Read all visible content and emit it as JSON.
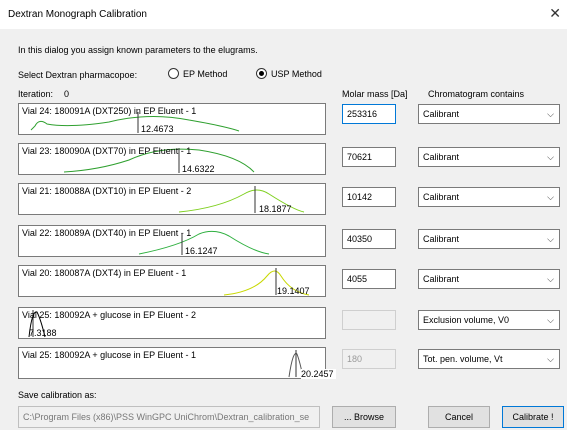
{
  "window": {
    "title": "Dextran Monograph Calibration",
    "close_glyph": "✕"
  },
  "intro": "In this dialog you assign known parameters to the elugrams.",
  "pharmacopoe": {
    "label": "Select Dextran pharmacopoe:",
    "options": [
      {
        "label": "EP Method",
        "selected": false
      },
      {
        "label": "USP Method",
        "selected": true
      }
    ]
  },
  "iteration": {
    "label": "Iteration:",
    "value": "0"
  },
  "columns": {
    "molar_mass": "Molar mass [Da]",
    "contains": "Chromatogram contains"
  },
  "rows": [
    {
      "vial": "Vial  24: 180091A (DXT250) in EP Eluent - 1",
      "peak": "12.4673",
      "molar_mass": "253316",
      "contains": "Calibrant",
      "mass_state": "focused",
      "curve_color": "#2fa02f"
    },
    {
      "vial": "Vial  23: 180090A (DXT70) in EP Eluent - 1",
      "peak": "14.6322",
      "molar_mass": "70621",
      "contains": "Calibrant",
      "mass_state": "normal",
      "curve_color": "#2fa02f"
    },
    {
      "vial": "Vial  21: 180088A (DXT10)  in EP Eluent - 2",
      "peak": "18.1877",
      "molar_mass": "10142",
      "contains": "Calibrant",
      "mass_state": "normal",
      "curve_color": "#7fd020"
    },
    {
      "vial": "Vial  22: 180089A (DXT40) in EP Eluent - 1",
      "peak": "16.1247",
      "molar_mass": "40350",
      "contains": "Calibrant",
      "mass_state": "normal",
      "curve_color": "#2fb040"
    },
    {
      "vial": "Vial  20: 180087A (DXT4) in EP Eluent - 1",
      "peak": "19.1407",
      "molar_mass": "4055",
      "contains": "Calibrant",
      "mass_state": "normal",
      "curve_color": "#c8d800"
    },
    {
      "vial": "Vial  25: 180092A + glucose in EP Eluent - 2",
      "peak": "7.3188",
      "molar_mass": "",
      "contains": "Exclusion volume, V0",
      "mass_state": "disabled",
      "curve_color": "#000000"
    },
    {
      "vial": "Vial  25: 180092A + glucose in EP Eluent - 1",
      "peak": "20.2457",
      "molar_mass": "180",
      "contains": "Tot. pen. volume, Vt",
      "mass_state": "disabled",
      "curve_color": "#555555"
    }
  ],
  "save": {
    "label": "Save calibration as:",
    "path": "C:\\Program Files (x86)\\PSS WinGPC UniChrom\\Dextran_calibration_se"
  },
  "buttons": {
    "browse": "... Browse",
    "cancel": "Cancel",
    "calibrate": "Calibrate !"
  },
  "icons": {
    "chevron": "chevron-down-icon",
    "radio": "radio-icon",
    "close": "close-icon"
  }
}
